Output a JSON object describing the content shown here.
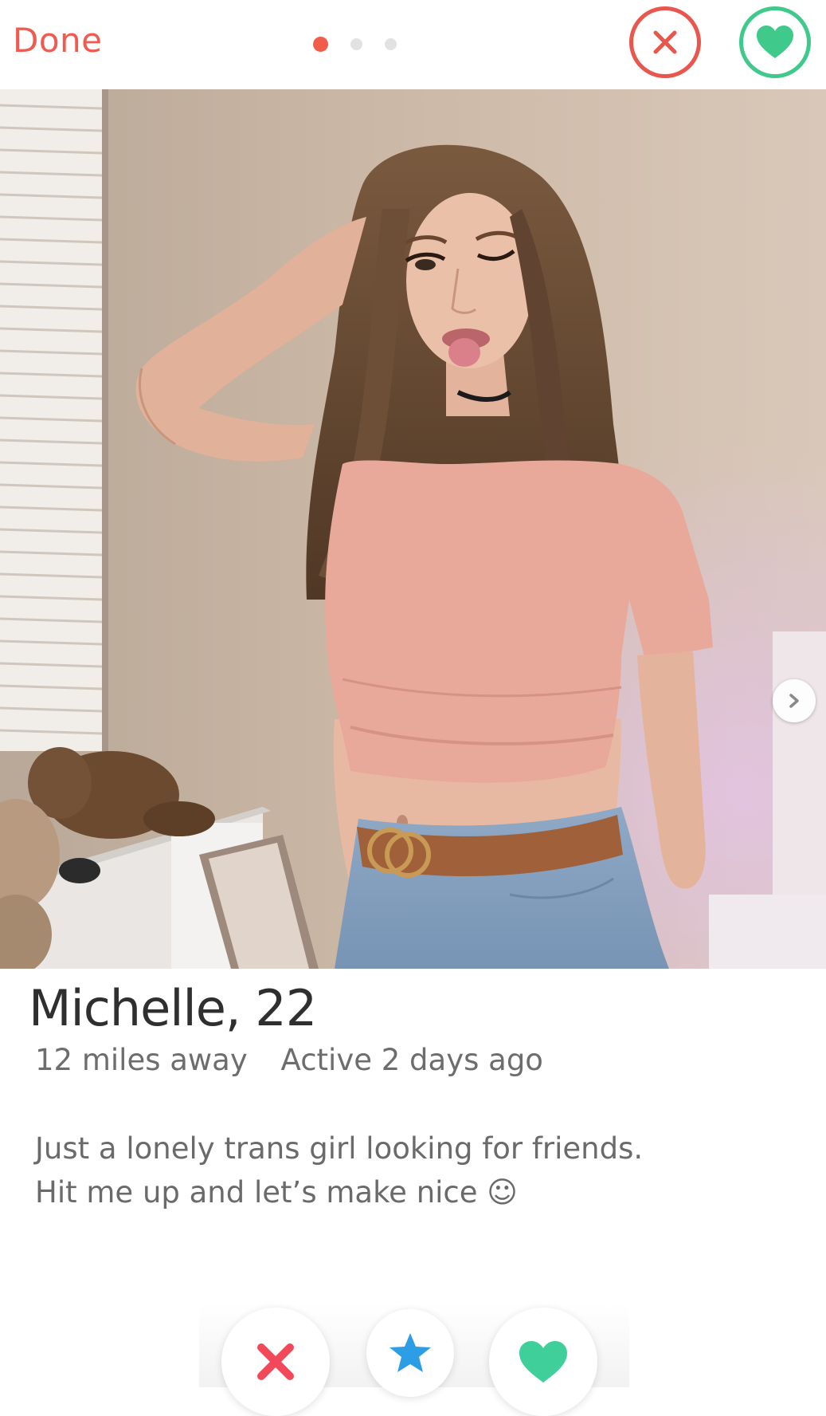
{
  "header": {
    "done_label": "Done",
    "photo_count": 3,
    "active_photo_index": 0
  },
  "photo": {
    "alt": ""
  },
  "profile": {
    "name_age": "Michelle, 22",
    "distance": "12 miles away",
    "activity": "Active 2 days ago",
    "bio_line_1": "Just a lonely trans girl looking for friends.",
    "bio_line_2": "Hit me up and let’s make nice ☺"
  },
  "colors": {
    "accent_red": "#f25c4a",
    "nope_red": "#e8564d",
    "like_green": "#3fc98a",
    "super_like_blue": "#2d9de6",
    "text_dark": "#2f2f2f",
    "text_muted": "#6d6d6d"
  },
  "icons": {
    "top_nope": "x-circle-icon",
    "top_like": "heart-circle-icon",
    "next_photo": "chevron-right-icon",
    "nope": "x-icon",
    "super_like": "star-icon",
    "like": "heart-icon"
  }
}
